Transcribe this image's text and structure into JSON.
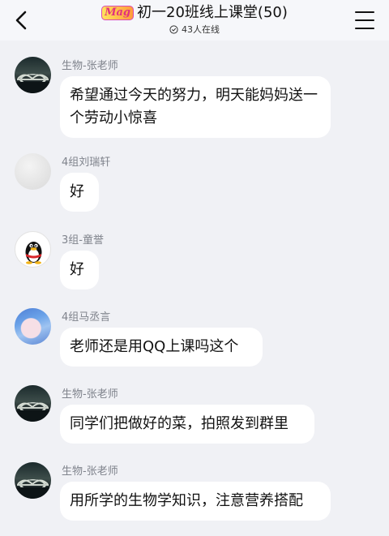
{
  "header": {
    "group_logo_text": "Mag",
    "title": "初一20班线上课堂(50)",
    "online_count": "43人在线"
  },
  "messages": [
    {
      "sender": "生物-张老师",
      "text": "希望通过今天的努力，明天能妈妈送一个劳动小惊喜",
      "avatar": "bridge-photo-avatar"
    },
    {
      "sender": "4组刘瑞轩",
      "text": "好",
      "avatar": "blank-avatar"
    },
    {
      "sender": "3组-童誉",
      "text": "好",
      "avatar": "qq-penguin-avatar"
    },
    {
      "sender": "4组马丞言",
      "text": "老师还是用QQ上课吗这个",
      "avatar": "anime-avatar"
    },
    {
      "sender": "生物-张老师",
      "text": "同学们把做好的菜，拍照发到群里",
      "avatar": "bridge-photo-avatar"
    },
    {
      "sender": "生物-张老师",
      "text": "用所学的生物学知识，注意营养搭配",
      "avatar": "bridge-photo-avatar"
    }
  ],
  "colors": {
    "background": "#f0f1f5",
    "bubble": "#ffffff",
    "sender_text": "#7f838c",
    "message_text": "#111111"
  }
}
